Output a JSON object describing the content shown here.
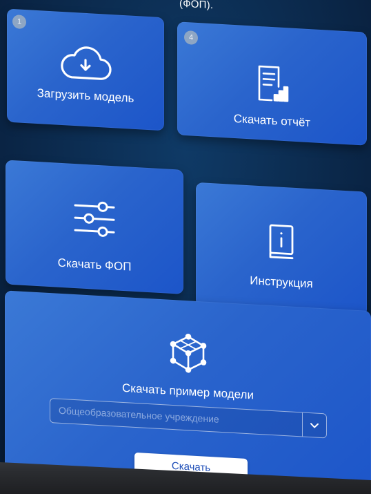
{
  "header": {
    "text": "(ФОП)."
  },
  "tiles": {
    "upload": {
      "badge": "1",
      "label": "Загрузить модель",
      "icon": "cloud-download-icon"
    },
    "report": {
      "badge": "4",
      "label": "Скачать отчёт",
      "icon": "report-chart-icon"
    },
    "fop": {
      "label": "Скачать ФОП",
      "icon": "sliders-icon"
    },
    "manual": {
      "label": "Инструкция",
      "icon": "info-book-icon"
    },
    "sample": {
      "label": "Скачать пример модели",
      "icon": "cube-3d-icon",
      "select": {
        "value": "Общеобразовательное учреждение"
      },
      "button": "Скачать"
    }
  },
  "colors": {
    "tile": "#2a64cc",
    "background": "#0b2a4a",
    "button_text": "#1f4fb8"
  }
}
